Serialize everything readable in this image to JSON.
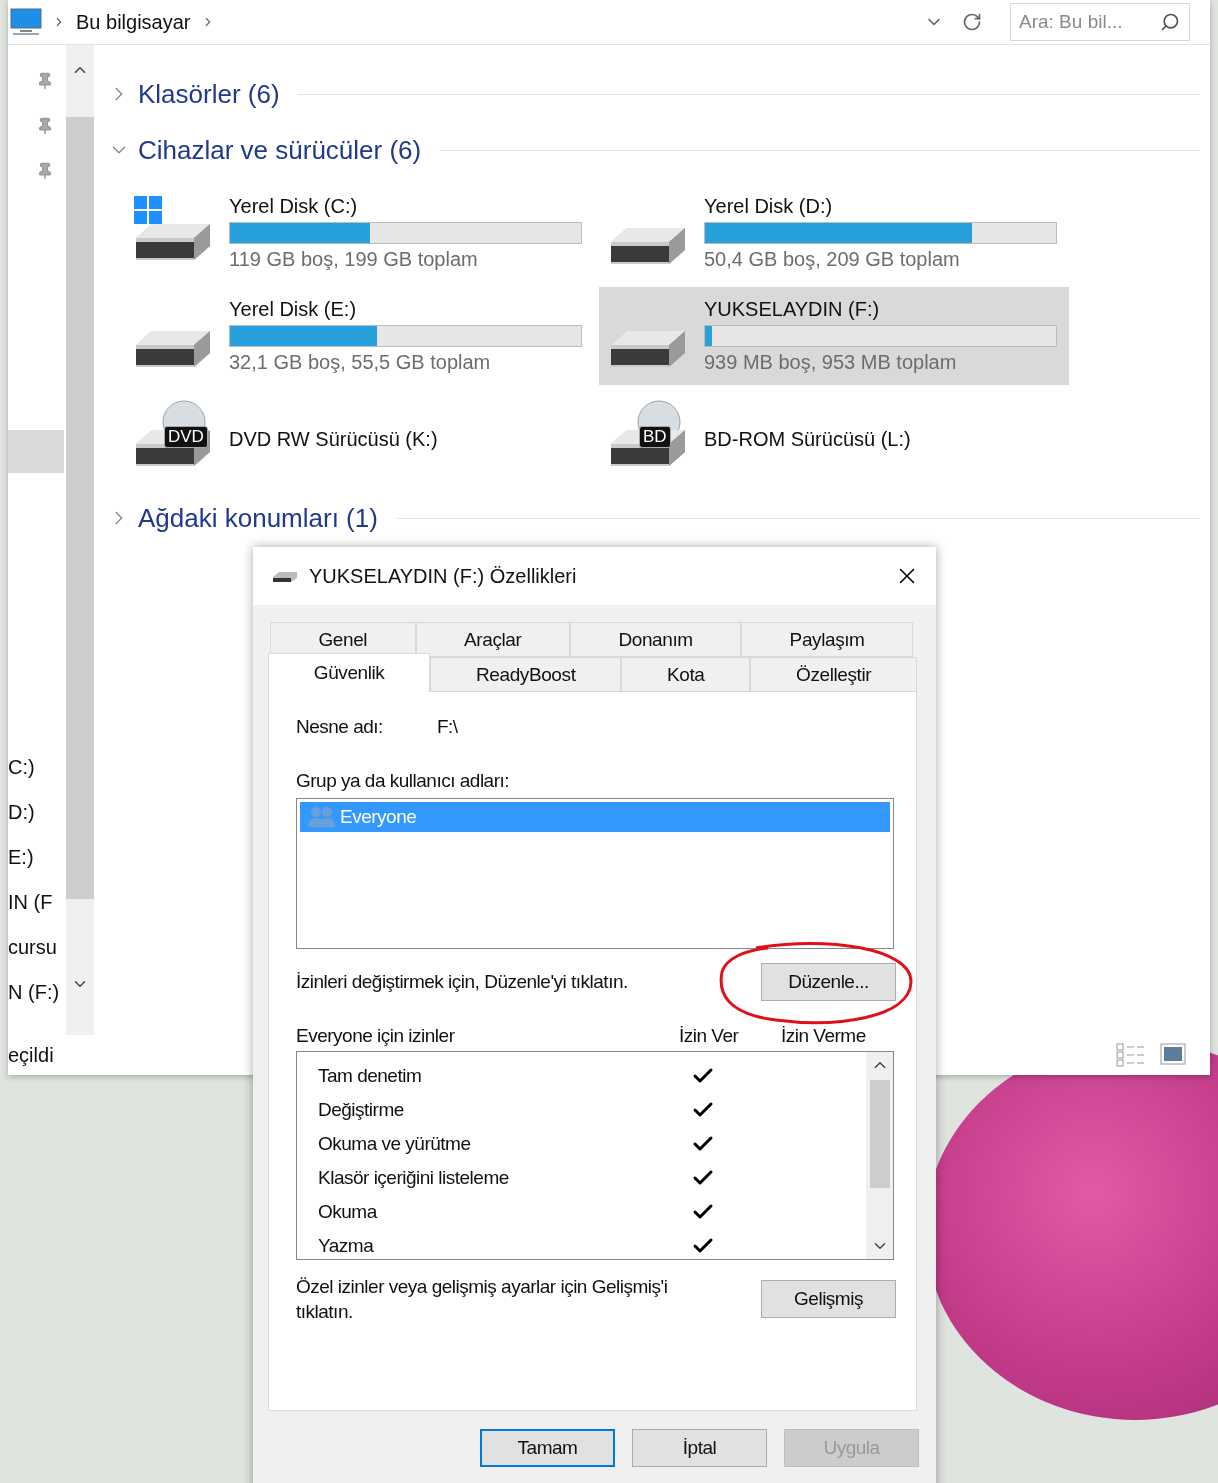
{
  "address_bar": {
    "breadcrumb": [
      "Bu bilgisayar"
    ],
    "search_placeholder": "Ara: Bu bil..."
  },
  "nav_pane": {
    "items": [
      {
        "selected": true
      },
      {
        "label": "C:)",
        "selected": false
      },
      {
        "label": "D:)",
        "selected": false
      },
      {
        "label": "E:)",
        "selected": false
      },
      {
        "label": "IN (F",
        "selected": false
      },
      {
        "label": "cursu",
        "selected": false
      },
      {
        "label": "N (F:)",
        "selected": false
      }
    ]
  },
  "sections": [
    {
      "title": "Klasörler (6)",
      "expanded": false
    },
    {
      "title": "Cihazlar ve sürücüler (6)",
      "expanded": true,
      "drives": [
        {
          "kind": "system_disk",
          "name": "Yerel Disk (C:)",
          "level": 0.4,
          "space": "119 GB boş, 199 GB toplam",
          "selected": false
        },
        {
          "kind": "disk",
          "name": "Yerel Disk (D:)",
          "level": 0.76,
          "space": "50,4 GB boş, 209 GB toplam",
          "selected": false
        },
        {
          "kind": "disk",
          "name": "Yerel Disk (E:)",
          "level": 0.42,
          "space": "32,1 GB boş, 55,5 GB toplam",
          "selected": false
        },
        {
          "kind": "disk",
          "name": "YUKSELAYDIN (F:)",
          "level": 0.02,
          "space": "939 MB boş, 953 MB toplam",
          "selected": true
        },
        {
          "kind": "optical",
          "badge": "DVD",
          "name": "DVD RW Sürücüsü (K:)",
          "selected": false
        },
        {
          "kind": "optical",
          "badge": "BD",
          "name": "BD-ROM Sürücüsü (L:)",
          "selected": false
        }
      ]
    },
    {
      "title": "Ağdaki konumları (1)",
      "expanded": false
    }
  ],
  "status_bar": {
    "text": "eçildi"
  },
  "dialog": {
    "title": "YUKSELAYDIN (F:) Özellikleri",
    "tab_rows": [
      [
        {
          "label": "Genel",
          "selected": false
        },
        {
          "label": "Araçlar",
          "selected": false
        },
        {
          "label": "Donanım",
          "selected": false
        },
        {
          "label": "Paylaşım",
          "selected": false
        }
      ],
      [
        {
          "label": "Güvenlik",
          "selected": true
        },
        {
          "label": "ReadyBoost",
          "selected": false
        },
        {
          "label": "Kota",
          "selected": false
        },
        {
          "label": "Özelleştir",
          "selected": false
        }
      ]
    ],
    "object_label": "Nesne adı:",
    "object_value": "F:\\",
    "users_label": "Grup ya da kullanıcı adları:",
    "users": [
      {
        "name": "Everyone",
        "selected": true
      }
    ],
    "edit_hint": "İzinleri değiştirmek için, Düzenle'yi tıklatın.",
    "edit_button": "Düzenle...",
    "permissions_label": "Everyone için izinler",
    "permission_columns": [
      "İzin Ver",
      "İzin Verme"
    ],
    "permissions": [
      {
        "name": "Tam denetim",
        "allow": true,
        "deny": false
      },
      {
        "name": "Değiştirme",
        "allow": true,
        "deny": false
      },
      {
        "name": "Okuma ve yürütme",
        "allow": true,
        "deny": false
      },
      {
        "name": "Klasör içeriğini listeleme",
        "allow": true,
        "deny": false
      },
      {
        "name": "Okuma",
        "allow": true,
        "deny": false
      },
      {
        "name": "Yazma",
        "allow": true,
        "deny": false
      }
    ],
    "advanced_hint": "Özel izinler veya gelişmiş ayarlar için Gelişmiş'i tıklatın.",
    "advanced_button": "Gelişmiş",
    "buttons": [
      {
        "label": "Tamam",
        "kind": "default",
        "disabled": false
      },
      {
        "label": "İptal",
        "kind": "normal",
        "disabled": false
      },
      {
        "label": "Uygula",
        "kind": "normal",
        "disabled": true
      }
    ]
  }
}
